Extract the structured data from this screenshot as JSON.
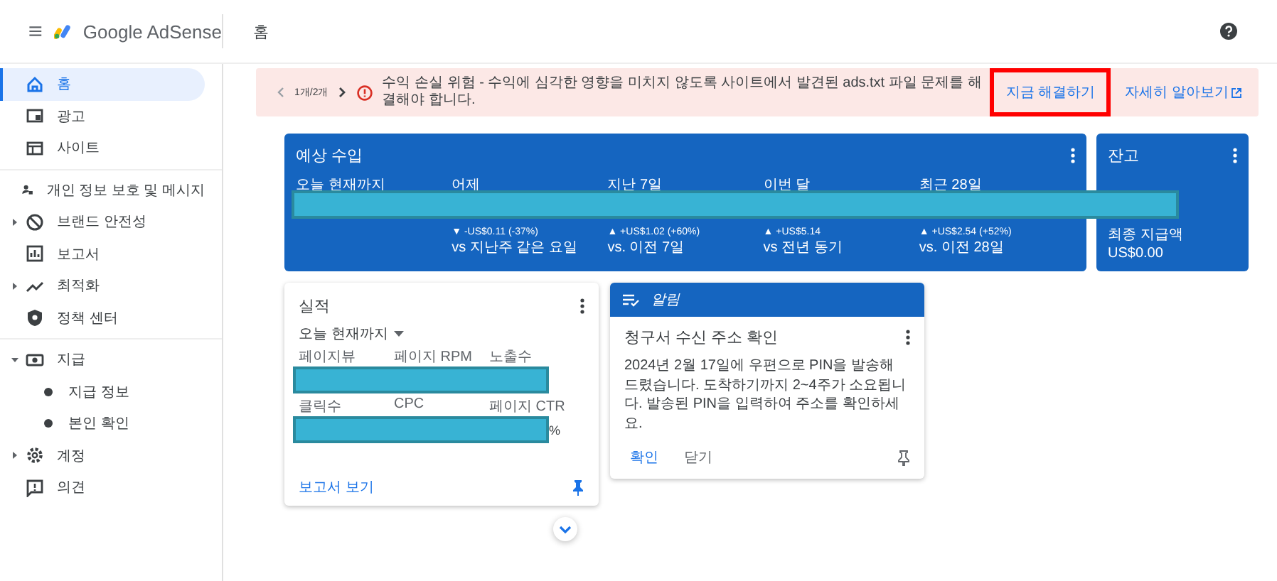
{
  "header": {
    "logo_text": "Google AdSense",
    "page_title": "홈"
  },
  "sidebar": {
    "groups": [
      {
        "items": [
          {
            "kind": "home",
            "label": "홈",
            "selected": true
          },
          {
            "kind": "ads",
            "label": "광고",
            "selected": false
          },
          {
            "kind": "sites",
            "label": "사이트",
            "selected": false
          }
        ]
      },
      {
        "items": [
          {
            "kind": "privacy",
            "label": "개인 정보 보호 및 메시지",
            "selected": false
          },
          {
            "kind": "block",
            "label": "브랜드 안전성",
            "selected": false,
            "expanded": false
          },
          {
            "kind": "reports",
            "label": "보고서",
            "selected": false
          },
          {
            "kind": "optimize",
            "label": "최적화",
            "selected": false,
            "expanded": false
          },
          {
            "kind": "policy",
            "label": "정책 센터",
            "selected": false
          }
        ]
      },
      {
        "items": [
          {
            "kind": "payments",
            "label": "지급",
            "selected": false,
            "expanded": true,
            "children": [
              {
                "label": "지급 정보",
                "selected": false
              },
              {
                "label": "본인 확인",
                "selected": false
              }
            ]
          },
          {
            "kind": "account",
            "label": "계정",
            "selected": false,
            "expanded": false
          },
          {
            "kind": "feedback",
            "label": "의견",
            "selected": false
          }
        ]
      }
    ]
  },
  "alert_bar": {
    "counter": "1개/2개",
    "message": "수익 손실 위험 - 수익에 심각한 영향을 미치지 않도록 사이트에서 발견된 ads.txt 파일 문제를 해결해야 합니다.",
    "actions": [
      {
        "label": "지금 해결하기",
        "highlighted": true,
        "external": false
      },
      {
        "label": "자세히 알아보기",
        "highlighted": false,
        "external": true
      }
    ]
  },
  "earnings_card": {
    "title": "예상 수입",
    "values_redacted": true,
    "columns": [
      {
        "label": "오늘 현재까지"
      },
      {
        "label": "어제",
        "change": "▼ -US$0.11 (-37%)",
        "compare": "vs 지난주 같은 요일"
      },
      {
        "label": "지난 7일",
        "change": "▲ +US$1.02 (+60%)",
        "compare": "vs. 이전 7일"
      },
      {
        "label": "이번 달",
        "change": "▲ +US$5.14",
        "compare": "vs 전년 동기"
      },
      {
        "label": "최근 28일",
        "change": "▲ +US$2.54 (+52%)",
        "compare": "vs. 이전 28일"
      }
    ]
  },
  "balance_card": {
    "title": "잔고",
    "last_payment_label": "최종 지급액",
    "last_payment": "US$0.00"
  },
  "performance_card": {
    "title": "실적",
    "range": "오늘 현재까지",
    "rows": [
      {
        "labels": [
          "페이지뷰",
          "페이지 RPM",
          "노출수"
        ],
        "redacted": true
      },
      {
        "labels": [
          "클릭수",
          "CPC",
          "페이지 CTR"
        ],
        "redacted": true,
        "visible_tail": "%"
      }
    ],
    "link": "보고서 보기",
    "pinned": true
  },
  "notice_card": {
    "header": "알림",
    "title": "청구서 수신 주소 확인",
    "body": "2024년 2월 17일에 우편으로 PIN을 발송해 드렸습니다. 도착하기까지 2~4주가 소요됩니다. 발송된 PIN을 입력하여 주소를 확인하세요.",
    "actions": [
      "확인",
      "닫기"
    ],
    "pinned": false
  }
}
